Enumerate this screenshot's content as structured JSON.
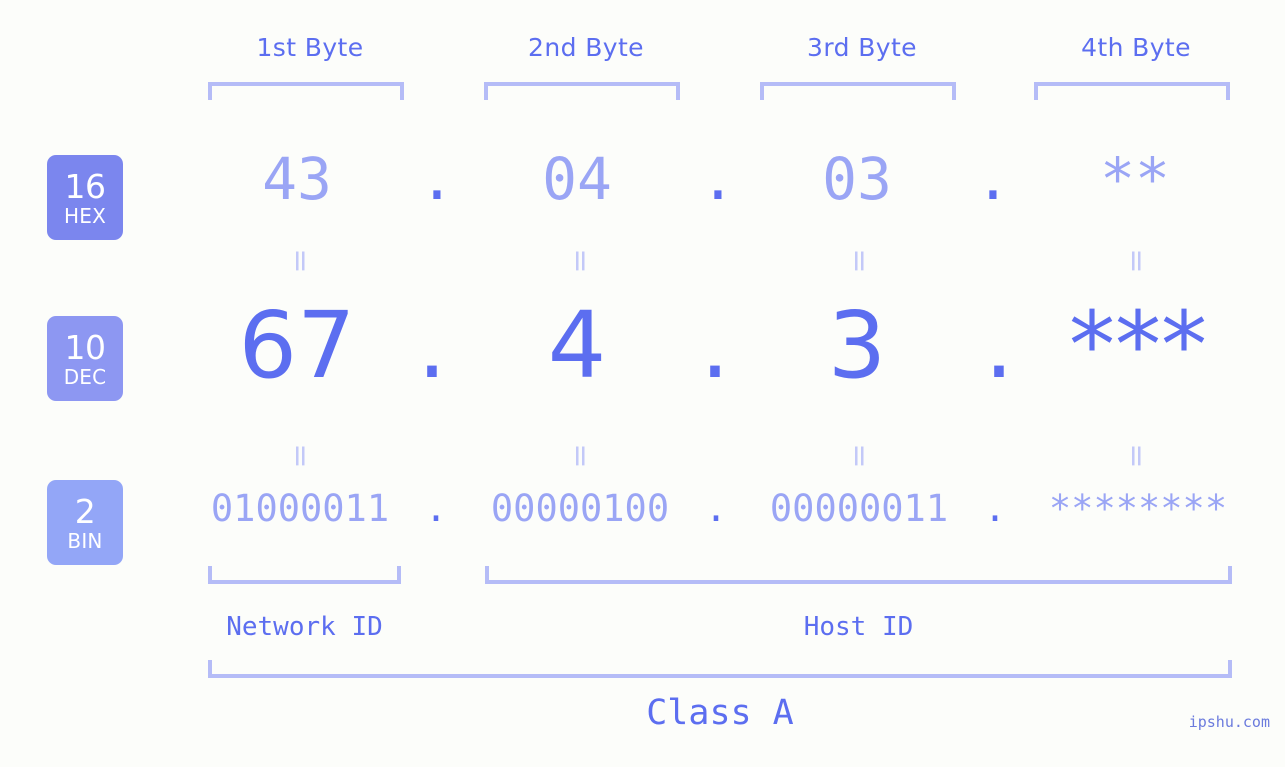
{
  "meta": {
    "background_color": "#fcfdfa",
    "accent_color": "#5c6ef0",
    "muted_color": "#9aa5f5",
    "bracket_color": "#b5bcf7"
  },
  "header": {
    "byte_labels": [
      "1st Byte",
      "2nd Byte",
      "3rd Byte",
      "4th Byte"
    ]
  },
  "bases": [
    {
      "number": "16",
      "unit": "HEX",
      "color": "#7b86ee"
    },
    {
      "number": "10",
      "unit": "DEC",
      "color": "#8d97f2"
    },
    {
      "number": "2",
      "unit": "BIN",
      "color": "#93a6f7"
    }
  ],
  "rows": {
    "hex": {
      "values": [
        "43",
        "04",
        "03",
        "**"
      ],
      "separator": "."
    },
    "dec": {
      "values": [
        "67",
        "4",
        "3",
        "***"
      ],
      "separator": "."
    },
    "bin": {
      "values": [
        "01000011",
        "00000100",
        "00000011",
        "********"
      ],
      "separator": "."
    }
  },
  "connectors": {
    "equals": "="
  },
  "segments": {
    "network_id": "Network ID",
    "host_id": "Host ID"
  },
  "footer": {
    "class_label": "Class A",
    "watermark": "ipshu.com"
  }
}
